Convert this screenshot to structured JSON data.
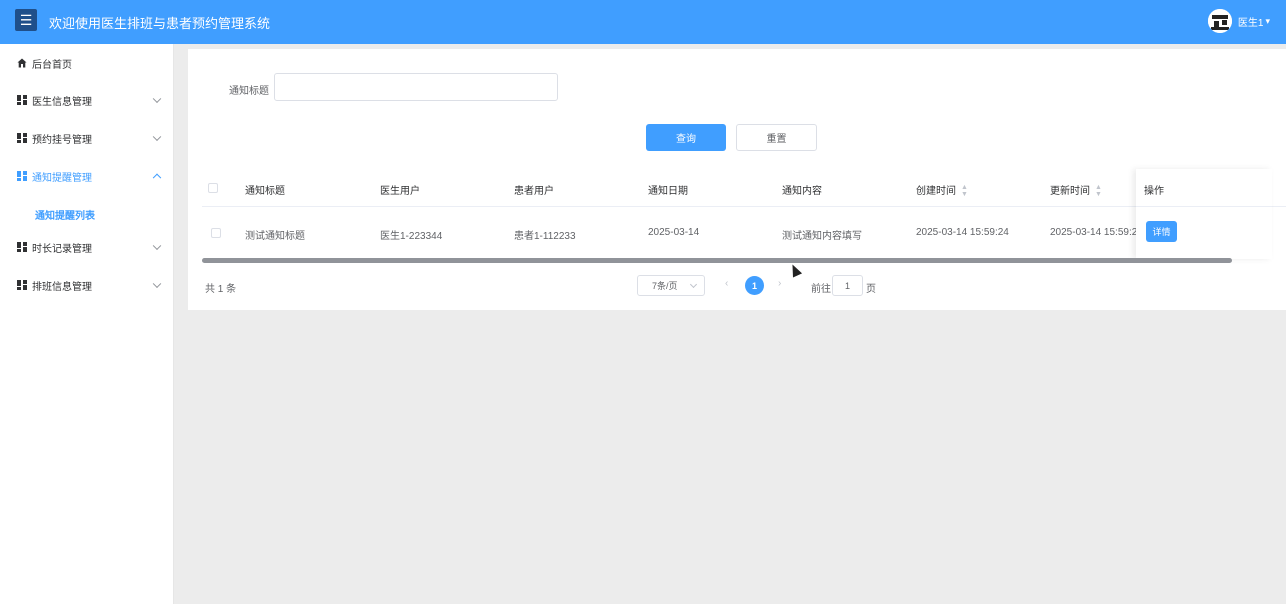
{
  "header": {
    "title": "欢迎使用医生排班与患者预约管理系统",
    "menu_icon": "menu-icon",
    "user_name": "医生1"
  },
  "sidebar": {
    "items": [
      {
        "label": "后台首页",
        "icon": "home-icon"
      },
      {
        "label": "医生信息管理",
        "icon": "grid-icon"
      },
      {
        "label": "预约挂号管理",
        "icon": "grid-icon"
      },
      {
        "label": "通知提醒管理",
        "icon": "grid-icon",
        "active": true
      },
      {
        "label": "时长记录管理",
        "icon": "grid-icon"
      },
      {
        "label": "排班信息管理",
        "icon": "grid-icon"
      }
    ],
    "sub_item": "通知提醒列表"
  },
  "search": {
    "label": "通知标题",
    "value": "",
    "query_button": "查询",
    "reset_button": "重置"
  },
  "table": {
    "columns": [
      "通知标题",
      "医生用户",
      "患者用户",
      "通知日期",
      "通知内容",
      "创建时间",
      "更新时间",
      "操作"
    ],
    "rows": [
      [
        "测试通知标题",
        "医生1-223344",
        "患者1-112233",
        "2025-03-14",
        "测试通知内容填写",
        "2025-03-14 15:59:24",
        "2025-03-14 15:59:2"
      ]
    ],
    "action_button": "详情"
  },
  "pagination": {
    "total": "共 1 条",
    "page_size": "7条/页",
    "current_page": "1",
    "goto_prefix": "前往",
    "goto_value": "1",
    "goto_suffix": "页"
  },
  "colors": {
    "primary": "#409eff",
    "header_bg": "#409eff"
  }
}
